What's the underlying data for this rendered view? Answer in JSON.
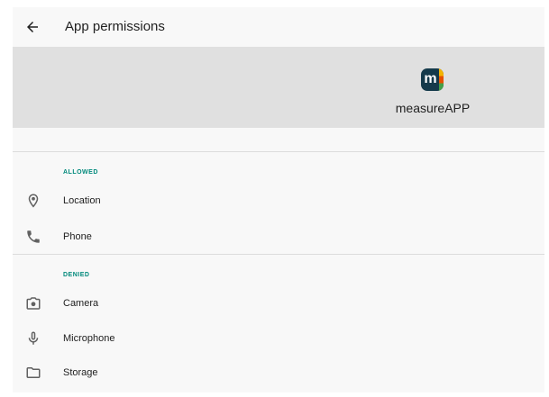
{
  "toolbar": {
    "title": "App permissions",
    "back_icon": "arrow-back-icon"
  },
  "app": {
    "name": "measureAPP",
    "icon_letter": "m",
    "icon_bg": "#153a4b",
    "icon_stripe_colors": [
      "#f4b400",
      "#e65100",
      "#43a047"
    ]
  },
  "sections": {
    "allowed": {
      "label": "ALLOWED",
      "items": [
        {
          "label": "Location",
          "icon": "location-pin-icon"
        },
        {
          "label": "Phone",
          "icon": "phone-icon"
        }
      ]
    },
    "denied": {
      "label": "DENIED",
      "items": [
        {
          "label": "Camera",
          "icon": "camera-icon"
        },
        {
          "label": "Microphone",
          "icon": "microphone-icon"
        },
        {
          "label": "Storage",
          "icon": "folder-icon"
        }
      ]
    }
  },
  "colors": {
    "accent": "#00897b",
    "header_bg": "#e0e0e0",
    "icon_gray": "#616161"
  }
}
